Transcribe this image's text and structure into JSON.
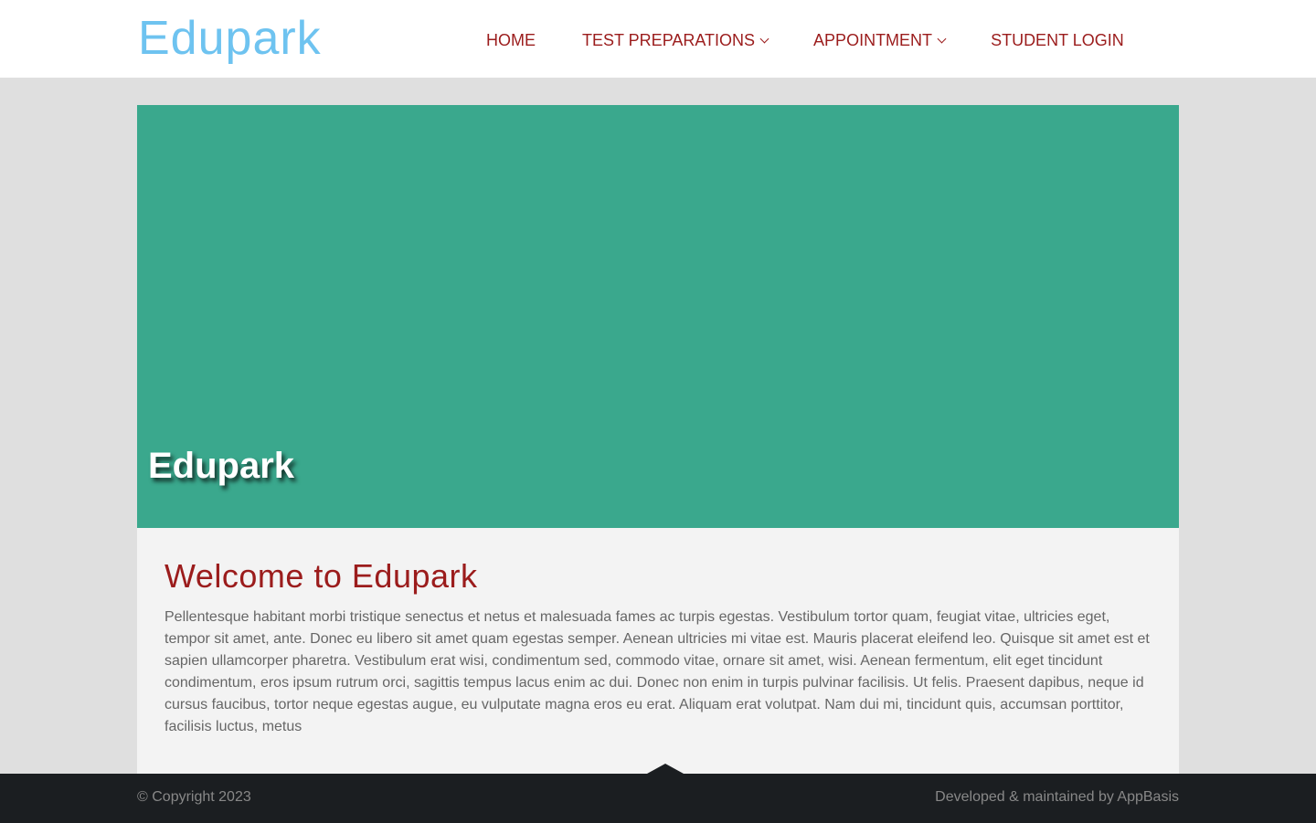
{
  "header": {
    "logo": "Edupark",
    "nav": [
      {
        "label": "HOME",
        "has_dropdown": false
      },
      {
        "label": "TEST PREPARATIONS",
        "has_dropdown": true
      },
      {
        "label": "APPOINTMENT",
        "has_dropdown": true
      },
      {
        "label": "STUDENT LOGIN",
        "has_dropdown": false
      }
    ]
  },
  "banner": {
    "title": "Edupark",
    "background_color": "#3aa88d"
  },
  "main": {
    "heading": "Welcome to Edupark",
    "body": "Pellentesque habitant morbi tristique senectus et netus et malesuada fames ac turpis egestas. Vestibulum tortor quam, feugiat vitae, ultricies eget, tempor sit amet, ante. Donec eu libero sit amet quam egestas semper. Aenean ultricies mi vitae est. Mauris placerat eleifend leo. Quisque sit amet est et sapien ullamcorper pharetra. Vestibulum erat wisi, condimentum sed, commodo vitae, ornare sit amet, wisi. Aenean fermentum, elit eget tincidunt condimentum, eros ipsum rutrum orci, sagittis tempus lacus enim ac dui. Donec non enim in turpis pulvinar facilisis. Ut felis. Praesent dapibus, neque id cursus faucibus, tortor neque egestas augue, eu vulputate magna eros eu erat. Aliquam erat volutpat. Nam dui mi, tincidunt quis, accumsan porttitor, facilisis luctus, metus"
  },
  "footer": {
    "copyright": "© Copyright 2023",
    "credit": "Developed & maintained by AppBasis"
  },
  "colors": {
    "logo": "#6ec3f0",
    "accent": "#9b1c1c",
    "footer_bg": "#1b1e21"
  },
  "icons": {
    "dropdown": "chevron-down-icon",
    "scroll_top": "caret-up-icon"
  }
}
